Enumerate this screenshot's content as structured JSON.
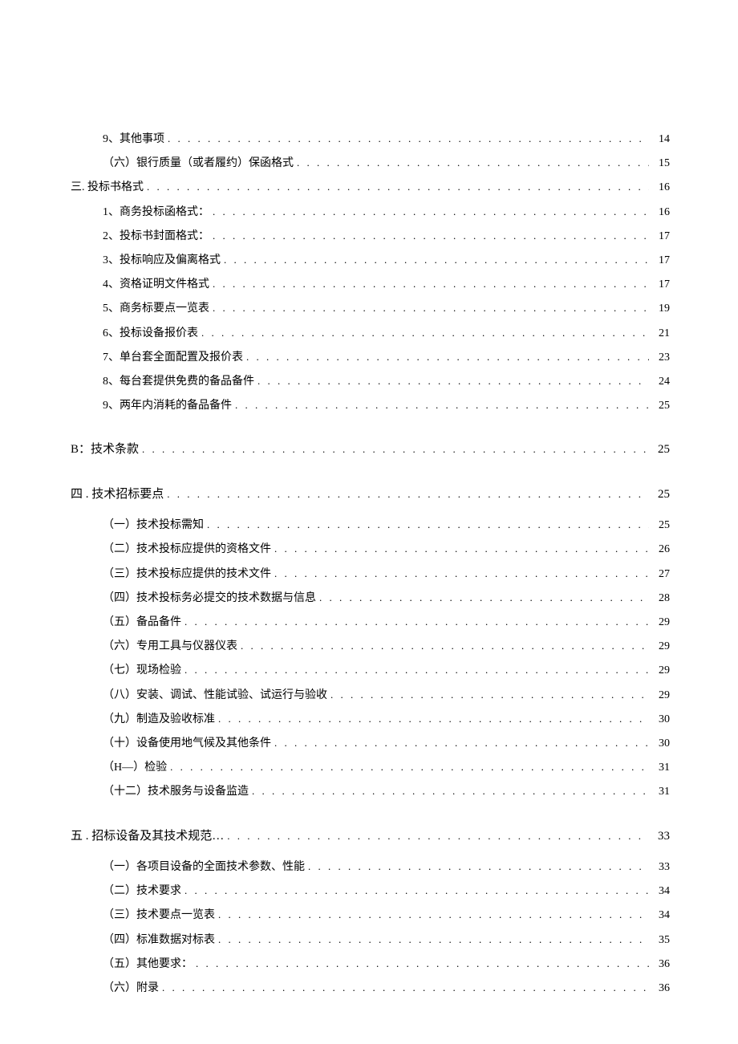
{
  "toc": [
    {
      "level": 2,
      "label": "9、其他事项",
      "page": "14",
      "section": false
    },
    {
      "level": 2,
      "label": "（六）银行质量（或者履约）保函格式",
      "page": "15",
      "section": false
    },
    {
      "level": 1,
      "label": "三. 投标书格式",
      "page": "16",
      "section": false
    },
    {
      "level": 2,
      "label": "1、商务投标函格式：",
      "page": "16",
      "section": false
    },
    {
      "level": 2,
      "label": "2、投标书封面格式：",
      "page": "17",
      "section": false
    },
    {
      "level": 2,
      "label": "3、投标响应及偏离格式",
      "page": "17",
      "section": false
    },
    {
      "level": 2,
      "label": "4、资格证明文件格式",
      "page": "17",
      "section": false
    },
    {
      "level": 2,
      "label": "5、商务标要点一览表",
      "page": "19",
      "section": false
    },
    {
      "level": 2,
      "label": "6、投标设备报价表",
      "page": "21",
      "section": false
    },
    {
      "level": 2,
      "label": "7、单台套全面配置及报价表",
      "page": "23",
      "section": false
    },
    {
      "level": 2,
      "label": "8、每台套提供免费的备品备件",
      "page": "24",
      "section": false
    },
    {
      "level": 2,
      "label": "9、两年内消耗的备品备件",
      "page": "25",
      "section": false
    },
    {
      "level": 1,
      "label": "B：技术条款",
      "page": "25",
      "section": true
    },
    {
      "level": 1,
      "label": "四  . 技术招标要点",
      "page": "25",
      "section": true
    },
    {
      "level": 2,
      "label": "（一）技术投标需知",
      "page": "25",
      "section": false
    },
    {
      "level": 2,
      "label": "（二）技术投标应提供的资格文件",
      "page": "26",
      "section": false
    },
    {
      "level": 2,
      "label": "（三）技术投标应提供的技术文件",
      "page": "27",
      "section": false
    },
    {
      "level": 2,
      "label": "（四）技术投标务必提交的技术数据与信息",
      "page": "28",
      "section": false
    },
    {
      "level": 2,
      "label": "（五）备品备件",
      "page": "29",
      "section": false
    },
    {
      "level": 2,
      "label": "（六）专用工具与仪器仪表",
      "page": "29",
      "section": false
    },
    {
      "level": 2,
      "label": "（七）现场检验",
      "page": "29",
      "section": false
    },
    {
      "level": 2,
      "label": "（八）安装、调试、性能试验、试运行与验收",
      "page": "29",
      "section": false
    },
    {
      "level": 2,
      "label": "（九）制造及验收标准",
      "page": "30",
      "section": false
    },
    {
      "level": 2,
      "label": "（十）设备使用地气候及其他条件",
      "page": "30",
      "section": false
    },
    {
      "level": 2,
      "label": "（H—）检验",
      "page": "31",
      "section": false
    },
    {
      "level": 2,
      "label": "（十二）技术服务与设备监造",
      "page": "31",
      "section": false
    },
    {
      "level": 1,
      "label": "五  . 招标设备及其技术规范… ",
      "page": "33",
      "section": true
    },
    {
      "level": 2,
      "label": "（一）各项目设备的全面技术参数、性能",
      "page": "33",
      "section": false
    },
    {
      "level": 2,
      "label": "（二）技术要求",
      "page": "34",
      "section": false
    },
    {
      "level": 2,
      "label": "（三）技术要点一览表",
      "page": "34",
      "section": false
    },
    {
      "level": 2,
      "label": "（四）标准数据对标表",
      "page": "35",
      "section": false
    },
    {
      "level": 2,
      "label": "（五）其他要求：",
      "page": "36",
      "section": false
    },
    {
      "level": 2,
      "label": "（六）附录",
      "page": "36",
      "section": false
    }
  ]
}
